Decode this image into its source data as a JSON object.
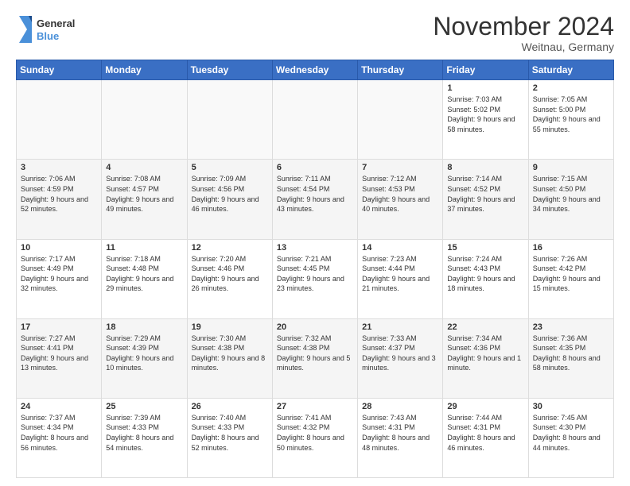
{
  "header": {
    "logo_line1": "General",
    "logo_line2": "Blue",
    "title": "November 2024",
    "subtitle": "Weitnau, Germany"
  },
  "weekdays": [
    "Sunday",
    "Monday",
    "Tuesday",
    "Wednesday",
    "Thursday",
    "Friday",
    "Saturday"
  ],
  "weeks": [
    [
      {
        "day": "",
        "info": ""
      },
      {
        "day": "",
        "info": ""
      },
      {
        "day": "",
        "info": ""
      },
      {
        "day": "",
        "info": ""
      },
      {
        "day": "",
        "info": ""
      },
      {
        "day": "1",
        "info": "Sunrise: 7:03 AM\nSunset: 5:02 PM\nDaylight: 9 hours and 58 minutes."
      },
      {
        "day": "2",
        "info": "Sunrise: 7:05 AM\nSunset: 5:00 PM\nDaylight: 9 hours and 55 minutes."
      }
    ],
    [
      {
        "day": "3",
        "info": "Sunrise: 7:06 AM\nSunset: 4:59 PM\nDaylight: 9 hours and 52 minutes."
      },
      {
        "day": "4",
        "info": "Sunrise: 7:08 AM\nSunset: 4:57 PM\nDaylight: 9 hours and 49 minutes."
      },
      {
        "day": "5",
        "info": "Sunrise: 7:09 AM\nSunset: 4:56 PM\nDaylight: 9 hours and 46 minutes."
      },
      {
        "day": "6",
        "info": "Sunrise: 7:11 AM\nSunset: 4:54 PM\nDaylight: 9 hours and 43 minutes."
      },
      {
        "day": "7",
        "info": "Sunrise: 7:12 AM\nSunset: 4:53 PM\nDaylight: 9 hours and 40 minutes."
      },
      {
        "day": "8",
        "info": "Sunrise: 7:14 AM\nSunset: 4:52 PM\nDaylight: 9 hours and 37 minutes."
      },
      {
        "day": "9",
        "info": "Sunrise: 7:15 AM\nSunset: 4:50 PM\nDaylight: 9 hours and 34 minutes."
      }
    ],
    [
      {
        "day": "10",
        "info": "Sunrise: 7:17 AM\nSunset: 4:49 PM\nDaylight: 9 hours and 32 minutes."
      },
      {
        "day": "11",
        "info": "Sunrise: 7:18 AM\nSunset: 4:48 PM\nDaylight: 9 hours and 29 minutes."
      },
      {
        "day": "12",
        "info": "Sunrise: 7:20 AM\nSunset: 4:46 PM\nDaylight: 9 hours and 26 minutes."
      },
      {
        "day": "13",
        "info": "Sunrise: 7:21 AM\nSunset: 4:45 PM\nDaylight: 9 hours and 23 minutes."
      },
      {
        "day": "14",
        "info": "Sunrise: 7:23 AM\nSunset: 4:44 PM\nDaylight: 9 hours and 21 minutes."
      },
      {
        "day": "15",
        "info": "Sunrise: 7:24 AM\nSunset: 4:43 PM\nDaylight: 9 hours and 18 minutes."
      },
      {
        "day": "16",
        "info": "Sunrise: 7:26 AM\nSunset: 4:42 PM\nDaylight: 9 hours and 15 minutes."
      }
    ],
    [
      {
        "day": "17",
        "info": "Sunrise: 7:27 AM\nSunset: 4:41 PM\nDaylight: 9 hours and 13 minutes."
      },
      {
        "day": "18",
        "info": "Sunrise: 7:29 AM\nSunset: 4:39 PM\nDaylight: 9 hours and 10 minutes."
      },
      {
        "day": "19",
        "info": "Sunrise: 7:30 AM\nSunset: 4:38 PM\nDaylight: 9 hours and 8 minutes."
      },
      {
        "day": "20",
        "info": "Sunrise: 7:32 AM\nSunset: 4:38 PM\nDaylight: 9 hours and 5 minutes."
      },
      {
        "day": "21",
        "info": "Sunrise: 7:33 AM\nSunset: 4:37 PM\nDaylight: 9 hours and 3 minutes."
      },
      {
        "day": "22",
        "info": "Sunrise: 7:34 AM\nSunset: 4:36 PM\nDaylight: 9 hours and 1 minute."
      },
      {
        "day": "23",
        "info": "Sunrise: 7:36 AM\nSunset: 4:35 PM\nDaylight: 8 hours and 58 minutes."
      }
    ],
    [
      {
        "day": "24",
        "info": "Sunrise: 7:37 AM\nSunset: 4:34 PM\nDaylight: 8 hours and 56 minutes."
      },
      {
        "day": "25",
        "info": "Sunrise: 7:39 AM\nSunset: 4:33 PM\nDaylight: 8 hours and 54 minutes."
      },
      {
        "day": "26",
        "info": "Sunrise: 7:40 AM\nSunset: 4:33 PM\nDaylight: 8 hours and 52 minutes."
      },
      {
        "day": "27",
        "info": "Sunrise: 7:41 AM\nSunset: 4:32 PM\nDaylight: 8 hours and 50 minutes."
      },
      {
        "day": "28",
        "info": "Sunrise: 7:43 AM\nSunset: 4:31 PM\nDaylight: 8 hours and 48 minutes."
      },
      {
        "day": "29",
        "info": "Sunrise: 7:44 AM\nSunset: 4:31 PM\nDaylight: 8 hours and 46 minutes."
      },
      {
        "day": "30",
        "info": "Sunrise: 7:45 AM\nSunset: 4:30 PM\nDaylight: 8 hours and 44 minutes."
      }
    ]
  ]
}
